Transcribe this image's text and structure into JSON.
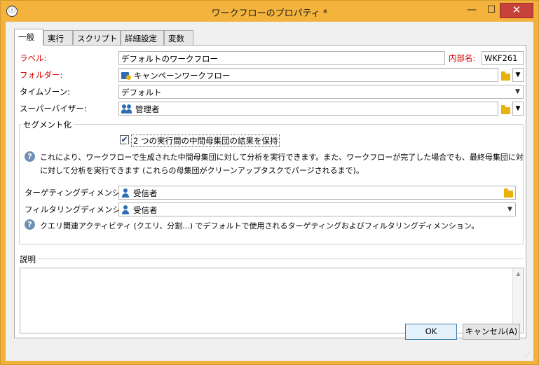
{
  "window": {
    "title": "ワークフローのプロパティ *",
    "minimize_glyph": "—",
    "maximize_glyph": "☐",
    "close_glyph": "✕"
  },
  "tabs": [
    {
      "label": "一般",
      "active": true
    },
    {
      "label": "実行",
      "active": false
    },
    {
      "label": "スクリプト",
      "active": false
    },
    {
      "label": "詳細設定",
      "active": false
    },
    {
      "label": "変数",
      "active": false
    }
  ],
  "general": {
    "label_label": "ラベル:",
    "label_value": "デフォルトのワークフロー",
    "internal_name_label": "内部名:",
    "internal_name_value": "WKF261",
    "folder_label": "フォルダー:",
    "folder_value": "キャンペーンワークフロー",
    "timezone_label": "タイムゾーン:",
    "timezone_value": "デフォルト",
    "supervisor_label": "スーパーバイザー:",
    "supervisor_value": "管理者"
  },
  "segmentation": {
    "legend": "セグメント化",
    "keep_checkbox_label": "2 つの実行間の中間母集団の結果を保持",
    "keep_checked": true,
    "help_line1": "これにより、ワークフローで生成された中間母集団に対して分析を実行できます。また、ワークフローが完了した場合でも、最終母集団に対して分析を",
    "help_line2": "に対して分析を実行できます (これらの母集団がクリーンアップタスクでパージされるまで)。",
    "targeting_label": "ターゲティングディメンション:",
    "targeting_value": "受信者",
    "filtering_label": "フィルタリングディメンション:",
    "filtering_value": "受信者",
    "query_help": "クエリ関連アクティビティ (クエリ、分割...) でデフォルトで使用されるターゲティングおよびフィルタリングディメンション。"
  },
  "description": {
    "legend": "説明",
    "value": ""
  },
  "buttons": {
    "ok": "OK",
    "cancel": "キャンセル(A)"
  },
  "colors": {
    "titlebar": "#f3b33d",
    "close": "#c7423a",
    "required_label": "#d20000",
    "icon_blue": "#2f6bb5",
    "folder_yellow": "#e8b10c"
  }
}
